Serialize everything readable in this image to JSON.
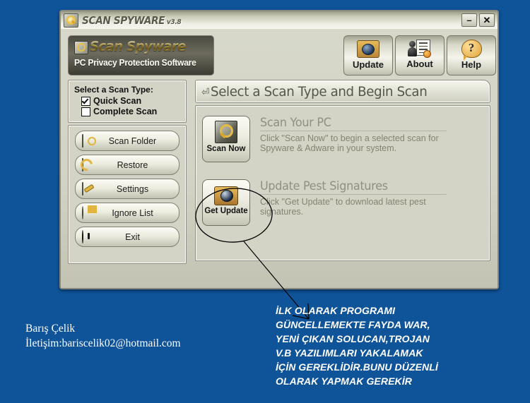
{
  "window": {
    "title": "SCAN SPYWARE",
    "version": "v3.8",
    "title_icon": "magnifier-icon",
    "minimize_label": "–",
    "close_label": "✕"
  },
  "brand": {
    "title": "Scan Spyware",
    "subtitle": "PC Privacy Protection Software",
    "logo_icon": "magnifier-logo-icon"
  },
  "toolbar": {
    "buttons": [
      {
        "label": "Update",
        "icon": "globe-monitor-icon"
      },
      {
        "label": "About",
        "icon": "person-document-icon"
      },
      {
        "label": "Help",
        "icon": "question-bubble-icon"
      }
    ]
  },
  "scan_type": {
    "title": "Select a Scan Type:",
    "options": [
      {
        "label": "Quick Scan",
        "checked": true
      },
      {
        "label": "Complete Scan",
        "checked": false
      }
    ]
  },
  "side_buttons": [
    {
      "label": "Scan Folder",
      "icon": "folder-search-icon"
    },
    {
      "label": "Restore",
      "icon": "restore-arrow-icon"
    },
    {
      "label": "Settings",
      "icon": "wrench-icon"
    },
    {
      "label": "Ignore List",
      "icon": "pie-list-icon"
    },
    {
      "label": "Exit",
      "icon": "power-icon"
    }
  ],
  "panel": {
    "header_icon": "⏎",
    "header_title": "Select a Scan Type and Begin Scan",
    "features": [
      {
        "button_label": "Scan Now",
        "icon": "magnifier-icon",
        "title": "Scan Your PC",
        "description": "Click \"Scan Now\" to begin a selected scan for Spyware & Adware in your system."
      },
      {
        "button_label": "Get Update",
        "icon": "globe-monitor-icon",
        "title": "Update Pest Signatures",
        "description": "Click \"Get Update\" to download latest pest signatures."
      }
    ]
  },
  "annotation": {
    "note": "İLK OLARAK PROGRAMI GÜNCELLEMEKTE FAYDA WAR, YENİ ÇIKAN SOLUCAN,TROJAN V.B YAZILIMLARI YAKALAMAK İÇİN GEREKLİDİR.BUNU DÜZENLİ OLARAK YAPMAK GEREKİR",
    "shape": "hand-drawn-ellipse-and-arrow"
  },
  "signature": {
    "name": "Barış Çelik",
    "contact": "İletişim:bariscelik02@hotmail.com"
  },
  "colors": {
    "desktop_background": "#0f5399",
    "panel_background": "#d3d4c6",
    "window_frame": "#88897c",
    "brand_gold": "#e4c96a",
    "annotation_white": "#ffffff"
  }
}
